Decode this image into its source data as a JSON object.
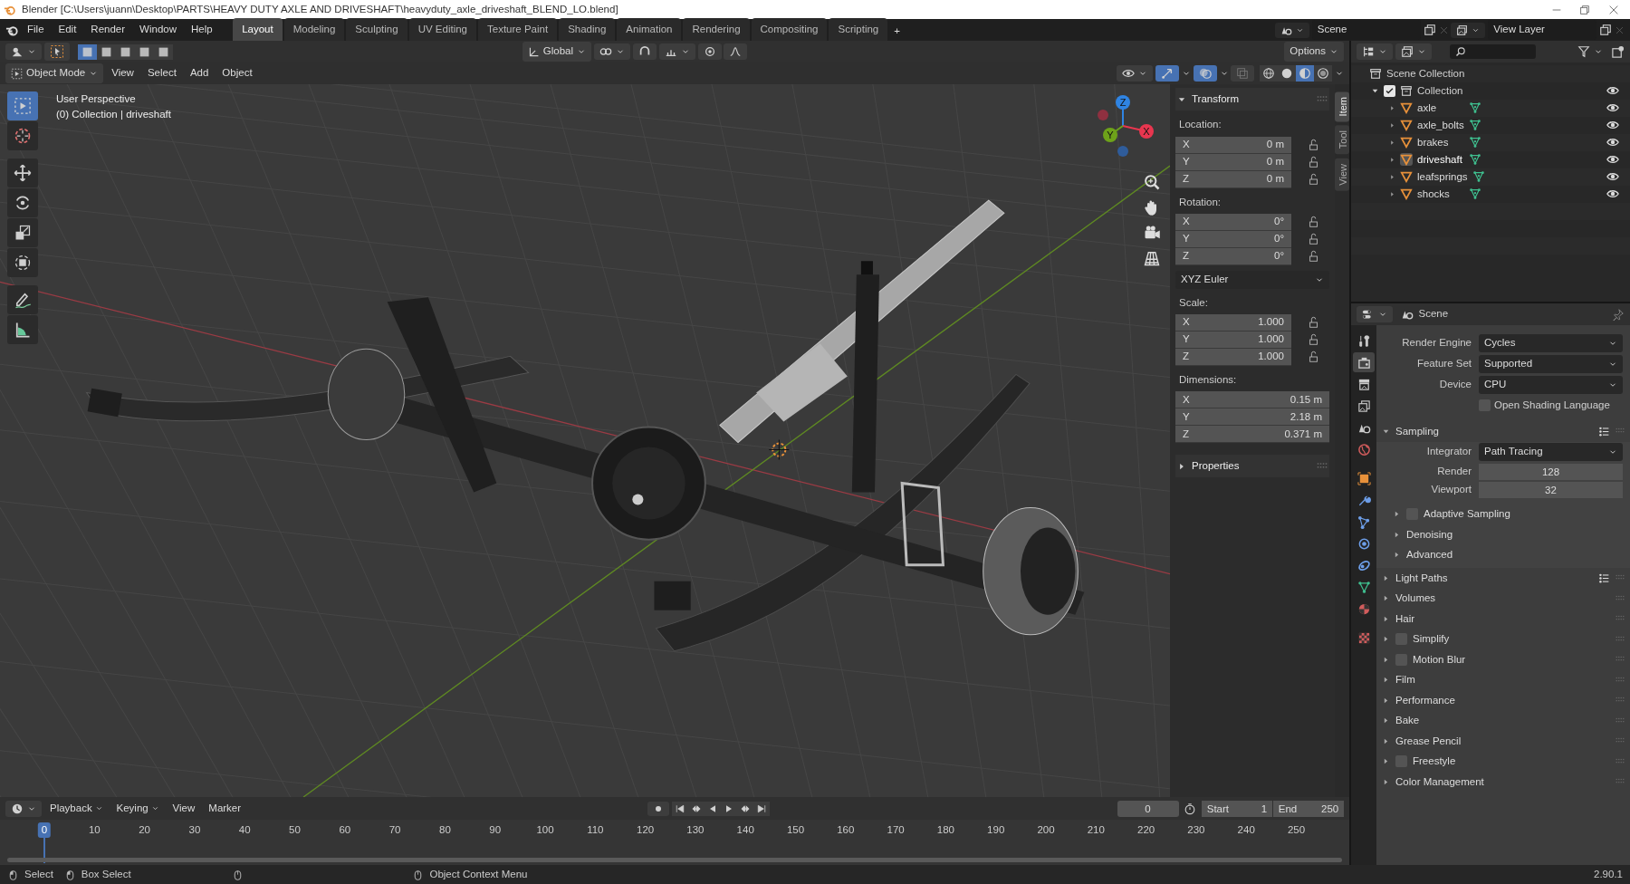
{
  "window": {
    "title": "Blender [C:\\Users\\juann\\Desktop\\PARTS\\HEAVY DUTY AXLE AND DRIVESHAFT\\heavyduty_axle_driveshaft_BLEND_LO.blend]"
  },
  "menus": [
    "File",
    "Edit",
    "Render",
    "Window",
    "Help"
  ],
  "workspaces": [
    {
      "label": "Layout",
      "selected": true
    },
    {
      "label": "Modeling",
      "selected": false
    },
    {
      "label": "Sculpting",
      "selected": false
    },
    {
      "label": "UV Editing",
      "selected": false
    },
    {
      "label": "Texture Paint",
      "selected": false
    },
    {
      "label": "Shading",
      "selected": false
    },
    {
      "label": "Animation",
      "selected": false
    },
    {
      "label": "Rendering",
      "selected": false
    },
    {
      "label": "Compositing",
      "selected": false
    },
    {
      "label": "Scripting",
      "selected": false
    }
  ],
  "add_workspace": "+",
  "scene_field": "Scene",
  "view_layer_field": "View Layer",
  "viewport": {
    "select_modes": [
      {
        "selected": true
      },
      {
        "selected": false
      },
      {
        "selected": false
      },
      {
        "selected": false
      },
      {
        "selected": false
      }
    ],
    "orientation": "Global",
    "options": "Options",
    "mode": "Object Mode",
    "header_menus": [
      "View",
      "Select",
      "Add",
      "Object"
    ],
    "gizmos_on": true,
    "overlays_on": true,
    "xray_on": false,
    "shading_modes": [
      {
        "kind": "wireframe",
        "selected": false
      },
      {
        "kind": "solid",
        "selected": false
      },
      {
        "kind": "material",
        "selected": true
      },
      {
        "kind": "rendered",
        "selected": false
      }
    ],
    "overlay_text": [
      "User Perspective",
      "(0) Collection | driveshaft"
    ],
    "tools": [
      {
        "kind": "select",
        "selected": true
      },
      {
        "kind": "cursor",
        "selected": false
      },
      {
        "kind": "move",
        "selected": false
      },
      {
        "kind": "rotate",
        "selected": false
      },
      {
        "kind": "scale",
        "selected": false
      },
      {
        "kind": "transform",
        "selected": false
      },
      {
        "kind": "annotate",
        "selected": false
      },
      {
        "kind": "measure",
        "selected": false
      }
    ],
    "gizmo_axes": [
      {
        "label": "Z",
        "color": "#2f84e3"
      },
      {
        "label": "X",
        "color": "#e8364f"
      },
      {
        "label": "Y",
        "color": "#6ea21a"
      }
    ]
  },
  "sidebar": {
    "tabs": [
      {
        "label": "Item",
        "selected": true
      },
      {
        "label": "Tool",
        "selected": false
      },
      {
        "label": "View",
        "selected": false
      }
    ],
    "panels": [
      {
        "title": "Transform",
        "expanded": true
      },
      {
        "title": "Properties",
        "expanded": false
      }
    ],
    "groups": [
      {
        "label": "Location:",
        "lockable": true,
        "fields": [
          {
            "axis": "X",
            "value": "0 m"
          },
          {
            "axis": "Y",
            "value": "0 m"
          },
          {
            "axis": "Z",
            "value": "0 m"
          }
        ]
      },
      {
        "label": "Rotation:",
        "lockable": true,
        "fields": [
          {
            "axis": "X",
            "value": "0°"
          },
          {
            "axis": "Y",
            "value": "0°"
          },
          {
            "axis": "Z",
            "value": "0°"
          }
        ],
        "dropdown": "XYZ Euler"
      },
      {
        "label": "Scale:",
        "lockable": true,
        "fields": [
          {
            "axis": "X",
            "value": "1.000"
          },
          {
            "axis": "Y",
            "value": "1.000"
          },
          {
            "axis": "Z",
            "value": "1.000"
          }
        ]
      },
      {
        "label": "Dimensions:",
        "lockable": false,
        "fields": [
          {
            "axis": "X",
            "value": "0.15 m"
          },
          {
            "axis": "Y",
            "value": "2.18 m"
          },
          {
            "axis": "Z",
            "value": "0.371 m"
          }
        ]
      }
    ]
  },
  "outliner": {
    "root": "Scene Collection",
    "collection": {
      "name": "Collection",
      "checked": true,
      "expanded": true,
      "visible": true,
      "children": [
        {
          "name": "axle",
          "selected": false,
          "visible": true
        },
        {
          "name": "axle_bolts",
          "selected": false,
          "visible": true
        },
        {
          "name": "brakes",
          "selected": false,
          "visible": true
        },
        {
          "name": "driveshaft",
          "selected": true,
          "visible": true
        },
        {
          "name": "leafsprings",
          "selected": false,
          "visible": true
        },
        {
          "name": "shocks",
          "selected": false,
          "visible": true
        }
      ]
    }
  },
  "properties": {
    "context": "Scene",
    "tabs": [
      {
        "kind": "tool",
        "selected": false
      },
      {
        "kind": "render",
        "selected": true
      },
      {
        "kind": "output",
        "selected": false
      },
      {
        "kind": "viewlayer",
        "selected": false
      },
      {
        "kind": "scene",
        "selected": false
      },
      {
        "kind": "world",
        "selected": false
      },
      {
        "kind": "object",
        "selected": false
      },
      {
        "kind": "modifier",
        "selected": false
      },
      {
        "kind": "particles",
        "selected": false
      },
      {
        "kind": "physics",
        "selected": false
      },
      {
        "kind": "constraints",
        "selected": false
      },
      {
        "kind": "data",
        "selected": false
      },
      {
        "kind": "material",
        "selected": false
      },
      {
        "kind": "texture",
        "selected": false
      }
    ],
    "rows": [
      {
        "kind": "dropdown",
        "label": "Render Engine",
        "value": "Cycles"
      },
      {
        "kind": "dropdown",
        "label": "Feature Set",
        "value": "Supported"
      },
      {
        "kind": "dropdown",
        "label": "Device",
        "value": "CPU"
      },
      {
        "kind": "checkbox",
        "label": "Open Shading Language",
        "checked": false
      }
    ],
    "sections": [
      {
        "title": "Sampling",
        "kind": "plain",
        "expanded": true,
        "presets": true,
        "rows": [
          {
            "kind": "dropdown",
            "label": "Integrator",
            "value": "Path Tracing"
          },
          {
            "kind": "number",
            "label": "Render",
            "value": "128"
          },
          {
            "kind": "number",
            "label": "Viewport",
            "value": "32"
          }
        ],
        "subpanels": [
          {
            "title": "Adaptive Sampling",
            "kind": "checkbox",
            "checked": false,
            "expanded": false
          },
          {
            "title": "Denoising",
            "kind": "plain",
            "expanded": false
          },
          {
            "title": "Advanced",
            "kind": "plain",
            "expanded": false
          }
        ]
      },
      {
        "title": "Light Paths",
        "kind": "plain",
        "expanded": false,
        "presets": true
      },
      {
        "title": "Volumes",
        "kind": "plain",
        "expanded": false,
        "presets": false
      },
      {
        "title": "Hair",
        "kind": "plain",
        "expanded": false,
        "presets": false
      },
      {
        "title": "Simplify",
        "kind": "checkbox",
        "checked": false,
        "expanded": false,
        "presets": false
      },
      {
        "title": "Motion Blur",
        "kind": "checkbox",
        "checked": false,
        "expanded": false,
        "presets": false
      },
      {
        "title": "Film",
        "kind": "plain",
        "expanded": false,
        "presets": false
      },
      {
        "title": "Performance",
        "kind": "plain",
        "expanded": false,
        "presets": false
      },
      {
        "title": "Bake",
        "kind": "plain",
        "expanded": false,
        "presets": false
      },
      {
        "title": "Grease Pencil",
        "kind": "plain",
        "expanded": false,
        "presets": false
      },
      {
        "title": "Freestyle",
        "kind": "checkbox",
        "checked": false,
        "expanded": false,
        "presets": false
      },
      {
        "title": "Color Management",
        "kind": "plain",
        "expanded": false,
        "presets": false
      }
    ]
  },
  "timeline": {
    "menus": [
      "Playback",
      "Keying",
      "View",
      "Marker"
    ],
    "current_frame": "0",
    "start_label": "Start",
    "start": "1",
    "end_label": "End",
    "end": "250",
    "ruler": [
      "0",
      "10",
      "20",
      "30",
      "40",
      "50",
      "60",
      "70",
      "80",
      "90",
      "100",
      "110",
      "120",
      "130",
      "140",
      "150",
      "160",
      "170",
      "180",
      "190",
      "200",
      "210",
      "220",
      "230",
      "240",
      "250"
    ]
  },
  "status_bar": {
    "hints": [
      "Select",
      "Box Select",
      "Object Context Menu"
    ],
    "version": "2.90.1"
  }
}
